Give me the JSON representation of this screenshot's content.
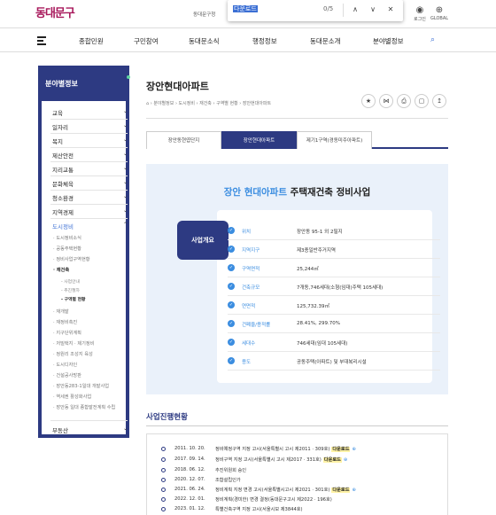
{
  "header": {
    "logo": "동대문구",
    "util_text": "동대문구청",
    "find": {
      "query": "다운로드",
      "count": "0/5",
      "up": "∧",
      "down": "∨",
      "close": "✕"
    },
    "login_label": "로그인",
    "global_label": "GLOBAL"
  },
  "nav": {
    "items": [
      "종합민원",
      "구민참여",
      "동대문소식",
      "행정정보",
      "동대문소개",
      "분야별정보"
    ]
  },
  "sidebar": {
    "title": "분야별정보",
    "items": [
      {
        "label": "교육",
        "arrow": "⌄"
      },
      {
        "label": "일자리",
        "arrow": "⌄"
      },
      {
        "label": "복지",
        "arrow": "⌄"
      },
      {
        "label": "제산안전",
        "arrow": "⌄"
      },
      {
        "label": "지리교통",
        "arrow": "⌄"
      },
      {
        "label": "문화체육",
        "arrow": "⌄"
      },
      {
        "label": "청소환경",
        "arrow": "⌄"
      },
      {
        "label": "지역경제",
        "arrow": "⌄"
      },
      {
        "label": "도시정비",
        "arrow": "⌃"
      }
    ],
    "sub_items": [
      "도시정비소식",
      "공동주택현황",
      "정비사업구역현황",
      "재건축"
    ],
    "subsub_items": [
      "- 사업안내",
      "- 추진절차",
      "- 구역별 현황"
    ],
    "sub_items2": [
      "재개발",
      "재정비촉진",
      "지구단위계획",
      "저밀택지 · 제기정비",
      "정원리 조성지 육성",
      "도시디자인",
      "건설공사망판",
      "장안동283-1일대 개발사업",
      "역세권 활성화사업",
      "장안동 일대 종합발전계획 수립"
    ],
    "last_item": {
      "label": "부동산",
      "arrow": "⌄"
    }
  },
  "content": {
    "title": "장안현대아파트",
    "breadcrumb": "⌂  ›  분야별정보  ›  도시정비  ›  재건축  ›  구역별 현황  ›  장안현대아파트",
    "tools": [
      "★",
      "⋈",
      "⎙",
      "▢",
      "↥"
    ],
    "tabs": [
      "장안동현엽단지",
      "장안현대아파트",
      "제기1구역(경동미주아파트)"
    ],
    "info": {
      "heading_blue": "장안 현대아파트",
      "heading_rest": " 주택재건축 정비사업",
      "badge": "사업개요",
      "rows": [
        {
          "label": "위치",
          "value": "장안동 95-1 외 2필지"
        },
        {
          "label": "지역지구",
          "value": "제3종일반주거지역"
        },
        {
          "label": "구역면적",
          "value": "25,244㎡"
        },
        {
          "label": "건축규모",
          "value": "7개동,746세대(소형(임대)주택 105세대)"
        },
        {
          "label": "연면적",
          "value": "125,732.39㎡"
        },
        {
          "label": "건폐율/용적률",
          "value": "28.41%, 299.70%"
        },
        {
          "label": "세대수",
          "value": "746세대(임대 105세대)"
        },
        {
          "label": "용도",
          "value": "공동주택(아파트) 및 부대복리시설"
        }
      ]
    },
    "history_title": "사업진행현황",
    "history": [
      {
        "date": "2011. 10. 20.",
        "desc": "정비예정구역 지정 고시(서울특별시 고시 제2011 · 309호)",
        "dl": "다운로드"
      },
      {
        "date": "2017. 09. 14.",
        "desc": "정비구역 지정 고시(서울특별시 고시 제2017 · 331호)",
        "dl": "다운로드"
      },
      {
        "date": "2018. 06. 12.",
        "desc": "추진위원회 승인",
        "dl": ""
      },
      {
        "date": "2020. 12. 07.",
        "desc": "조합설립인가",
        "dl": ""
      },
      {
        "date": "2021. 06. 24.",
        "desc": "정비계획 지정 변경 고시(서울특별시고시 제2021 · 301호)",
        "dl": "다운로드"
      },
      {
        "date": "2022. 12. 01.",
        "desc": "정비계획(경미한) 변경 결정(동대문구고시 제2022 · 196호)",
        "dl": ""
      },
      {
        "date": "2023. 01. 12.",
        "desc": "특별건축구역 지정 고시(서울시보 제3844호)",
        "dl": ""
      }
    ]
  },
  "colors": {
    "navy": "#2d3a82",
    "accent_blue": "#3b8de0",
    "logo": "#a8195c"
  }
}
